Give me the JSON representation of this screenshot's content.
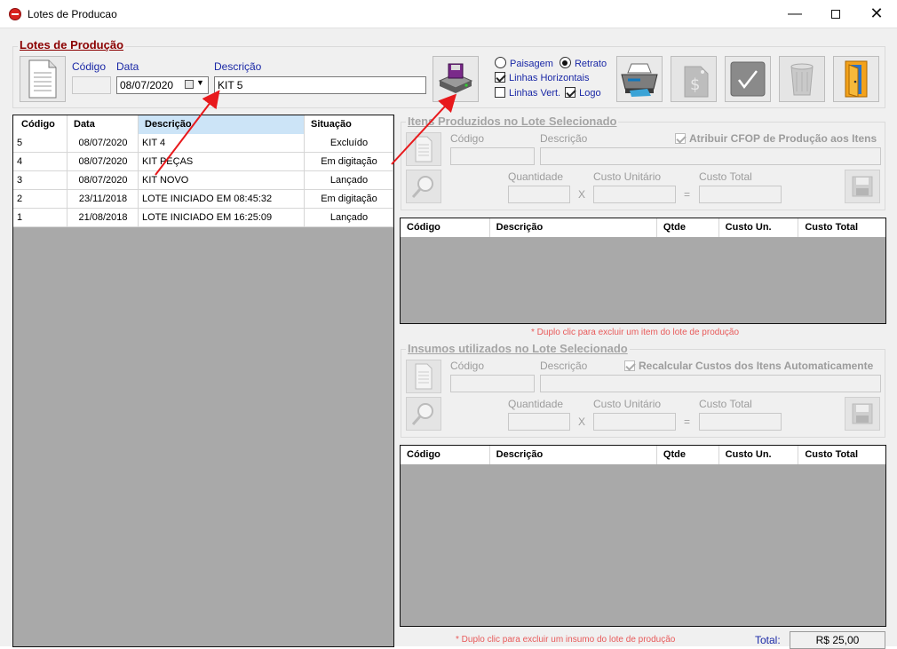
{
  "window": {
    "title": "Lotes de Producao"
  },
  "header": {
    "group_title": "Lotes de Produção",
    "codigo_label": "Código",
    "data_label": "Data",
    "data_value": "08/07/2020",
    "descricao_label": "Descrição",
    "descricao_value": "KIT 5",
    "codigo_value": ""
  },
  "options": {
    "paisagem": "Paisagem",
    "retrato": "Retrato",
    "linhas_horizontais": "Linhas Horizontais",
    "linhas_vert": "Linhas Vert.",
    "logo": "Logo"
  },
  "lotes_table": {
    "columns": [
      "Código",
      "Data",
      "Descrição",
      "Situação"
    ],
    "rows": [
      [
        "5",
        "08/07/2020",
        "KIT 4",
        "Excluído"
      ],
      [
        "4",
        "08/07/2020",
        "KIT PEÇAS",
        "Em digitação"
      ],
      [
        "3",
        "08/07/2020",
        "KIT NOVO",
        "Lançado"
      ],
      [
        "2",
        "23/11/2018",
        "LOTE INICIADO EM 08:45:32",
        "Em digitação"
      ],
      [
        "1",
        "21/08/2018",
        "LOTE INICIADO EM 16:25:09",
        "Lançado"
      ]
    ]
  },
  "itens": {
    "group_title": "Itens Produzidos no Lote Selecionado",
    "codigo_label": "Código",
    "descricao_label": "Descrição",
    "cfop_label": "Atribuir CFOP de Produção aos Itens",
    "quantidade_label": "Quantidade",
    "custo_unitario_label": "Custo Unitário",
    "custo_total_label": "Custo Total",
    "x_sign": "X",
    "eq_sign": "=",
    "columns": [
      "Código",
      "Descrição",
      "Qtde",
      "Custo Un.",
      "Custo Total"
    ],
    "note": "* Duplo clic para excluir um item do lote de produção"
  },
  "insumos": {
    "group_title": "Insumos utilizados no Lote Selecionado",
    "codigo_label": "Código",
    "descricao_label": "Descrição",
    "recalc_label": "Recalcular Custos dos Itens Automaticamente",
    "quantidade_label": "Quantidade",
    "custo_unitario_label": "Custo Unitário",
    "custo_total_label": "Custo Total",
    "x_sign": "X",
    "eq_sign": "=",
    "columns": [
      "Código",
      "Descrição",
      "Qtde",
      "Custo Un.",
      "Custo Total"
    ],
    "note": "* Duplo clic para excluir um insumo do lote de produção"
  },
  "footer": {
    "total_label": "Total:",
    "total_value": "R$ 25,00"
  },
  "colors": {
    "accent_red": "#8b0000",
    "arrow": "#e8191c",
    "grid_bg": "#a9a9a9"
  }
}
